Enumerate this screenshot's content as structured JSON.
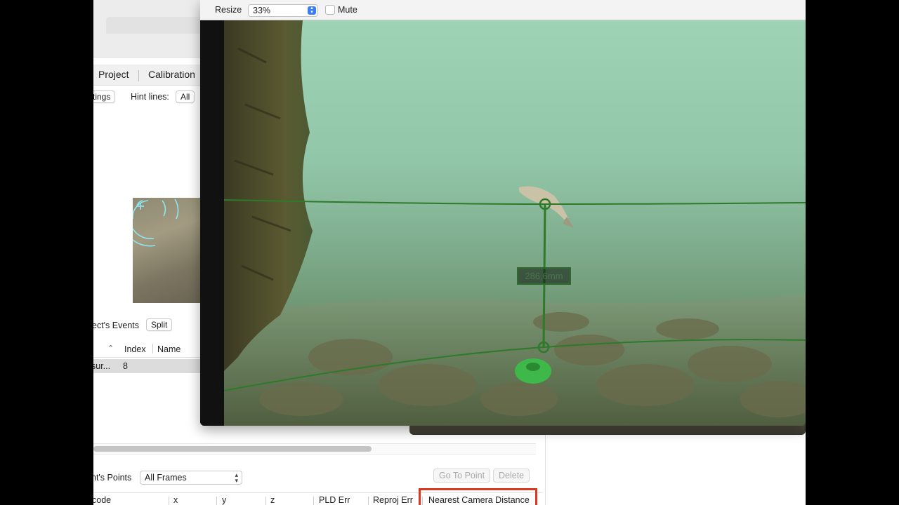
{
  "background_app": {
    "tabs": [
      {
        "label": "Project"
      },
      {
        "label": "Calibration"
      }
    ],
    "settings_button": "tings",
    "hint_lines_label": "Hint lines:",
    "hint_lines_value": "All",
    "events_label": "ect's Events",
    "split_button": "Split",
    "events_table": {
      "columns": [
        "Index",
        "Name"
      ],
      "rows": [
        {
          "name_cell": "sur...",
          "index": "8"
        }
      ]
    },
    "points_label": "nt's Points",
    "frames_select": "All Frames",
    "go_to_point_button": "Go To Point",
    "delete_button": "Delete",
    "points_columns": [
      "code",
      "x",
      "y",
      "z",
      "PLD Err",
      "Reproj Err",
      "Nearest Camera Distance"
    ]
  },
  "video_window": {
    "resize_label": "Resize",
    "zoom_value": "33%",
    "mute_label": "Mute",
    "mute_checked": false,
    "measurement_label": "286,6mm",
    "measure_color": "#2f7a2a"
  },
  "colors": {
    "highlight": "#d9371e",
    "accent": "#3a7cf5"
  }
}
